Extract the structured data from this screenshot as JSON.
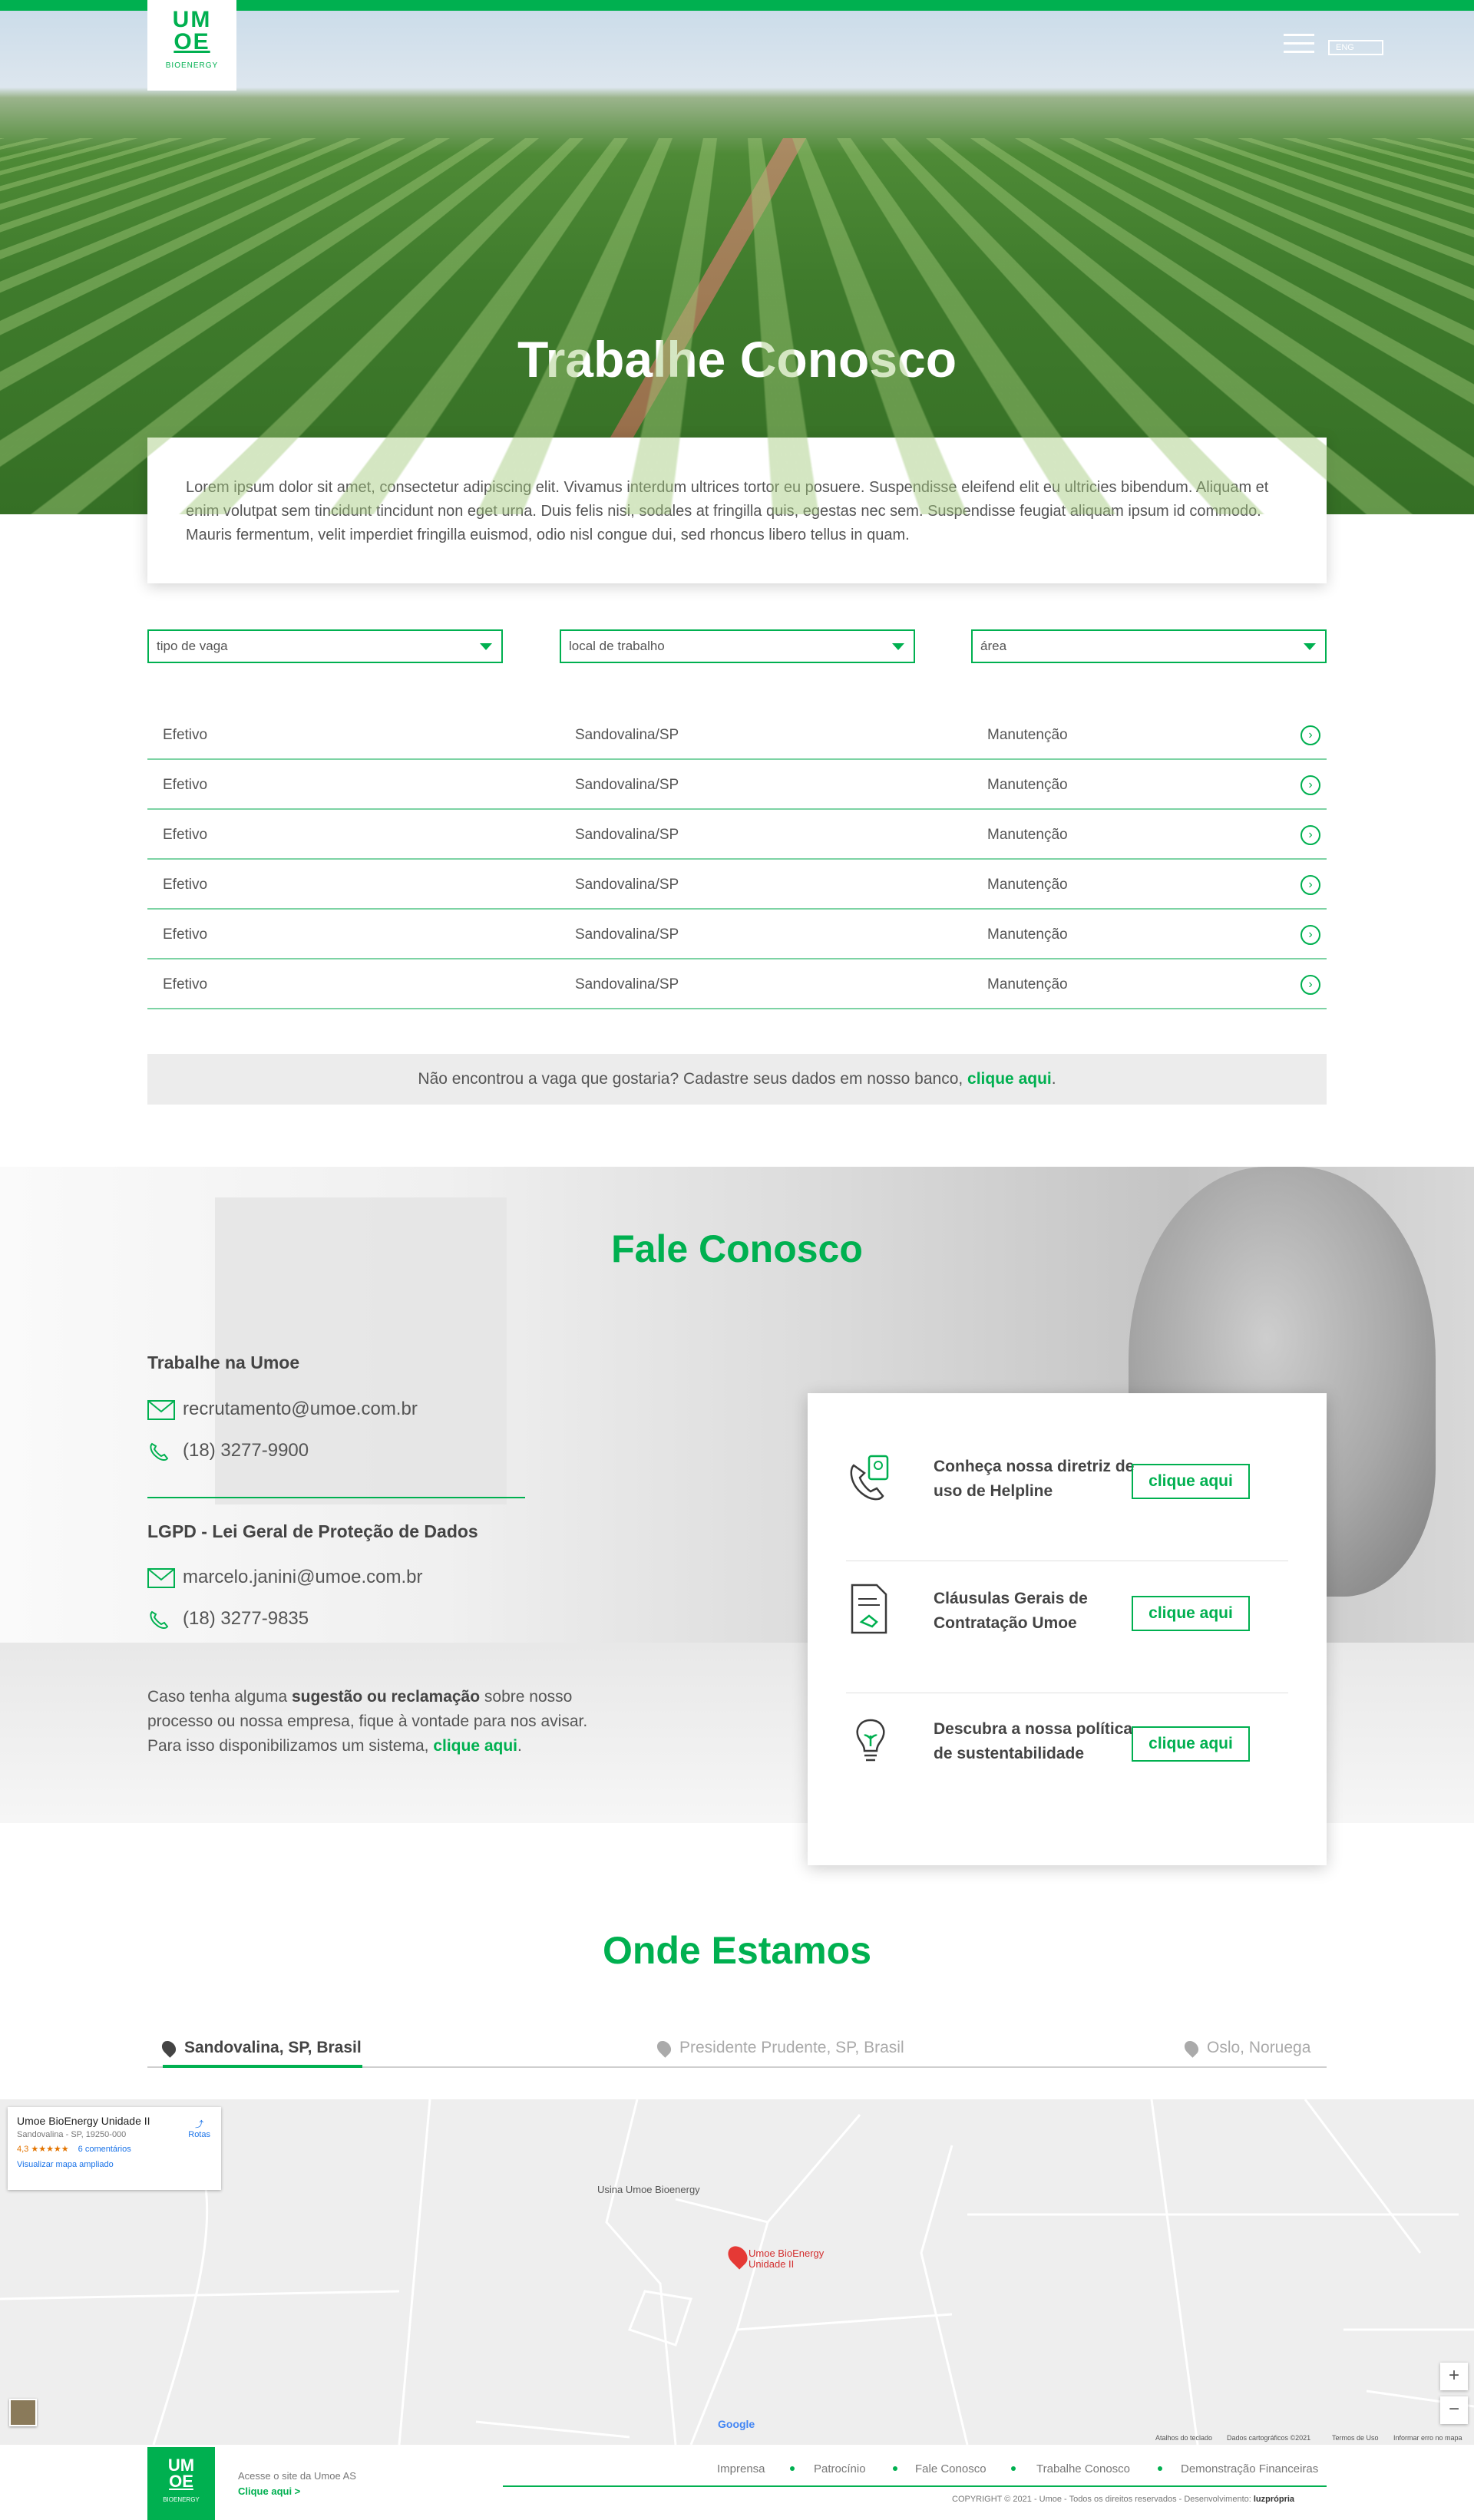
{
  "header": {
    "logo_top": "UM",
    "logo_bottom": "OE",
    "logo_sub": "BIOENERGY",
    "lang": "ENG"
  },
  "hero": {
    "title": "Trabalhe Conosco",
    "intro": "Lorem ipsum dolor sit amet, consectetur adipiscing elit. Vivamus interdum ultrices tortor eu posuere. Suspendisse eleifend elit eu ultricies bibendum. Aliquam et enim volutpat sem tincidunt tincidunt non eget urna. Duis felis nisi, sodales at fringilla quis, egestas nec sem. Suspendisse feugiat aliquam ipsum id commodo. Mauris fermentum, velit imperdiet fringilla euismod, odio nisl congue dui, sed rhoncus libero tellus in quam."
  },
  "filters": {
    "tipo": "tipo de vaga",
    "local": "local de trabalho",
    "area": "área"
  },
  "jobs": [
    {
      "tipo": "Efetivo",
      "local": "Sandovalina/SP",
      "area": "Manutenção"
    },
    {
      "tipo": "Efetivo",
      "local": "Sandovalina/SP",
      "area": "Manutenção"
    },
    {
      "tipo": "Efetivo",
      "local": "Sandovalina/SP",
      "area": "Manutenção"
    },
    {
      "tipo": "Efetivo",
      "local": "Sandovalina/SP",
      "area": "Manutenção"
    },
    {
      "tipo": "Efetivo",
      "local": "Sandovalina/SP",
      "area": "Manutenção"
    },
    {
      "tipo": "Efetivo",
      "local": "Sandovalina/SP",
      "area": "Manutenção"
    }
  ],
  "notice": {
    "text": "Não encontrou a vaga que gostaria? Cadastre seus dados em nosso banco, ",
    "link": "clique aqui",
    "end": "."
  },
  "contact": {
    "title": "Fale Conosco",
    "group1_title": "Trabalhe na Umoe",
    "group1_email": "recrutamento@umoe.com.br",
    "group1_phone": "(18) 3277-9900",
    "group2_title": "LGPD - Lei Geral de Proteção de Dados",
    "group2_email": "marcelo.janini@umoe.com.br",
    "group2_phone": "(18) 3277-9835",
    "note_1": "Caso tenha alguma ",
    "note_bold": "sugestão ou reclamação",
    "note_2": " sobre nosso processo ou nossa empresa, fique à vontade para nos avisar. Para isso disponibilizamos um sistema, ",
    "note_link": "clique aqui",
    "note_end": ".",
    "cards": [
      {
        "text": "Conheça nossa diretriz de uso de Helpline",
        "button": "clique aqui",
        "icon": "helpline-icon"
      },
      {
        "text": "Cláusulas Gerais de Contratação Umoe",
        "button": "clique aqui",
        "icon": "contract-icon"
      },
      {
        "text": "Descubra a nossa política de sustentabilidade",
        "button": "clique aqui",
        "icon": "lightbulb-icon"
      }
    ]
  },
  "where": {
    "title": "Onde Estamos",
    "tabs": [
      "Sandovalina, SP, Brasil",
      "Presidente Prudente, SP, Brasil",
      "Oslo, Noruega"
    ]
  },
  "map": {
    "place": "Umoe BioEnergy Unidade II",
    "address": "Sandovalina - SP, 19250-000",
    "rating": "4,3 ★★★★★",
    "reviews": "6 comentários",
    "enlarge": "Visualizar mapa ampliado",
    "routes": "Rotas",
    "label_usina": "Usina Umoe Bioenergy",
    "label_marker": "Umoe BioEnergy Unidade II",
    "zoom_in": "+",
    "zoom_out": "−",
    "google": "Google",
    "f1": "Atalhos do teclado",
    "f2": "Dados cartográficos ©2021",
    "f3": "Termos de Uso",
    "f4": "Informar erro no mapa"
  },
  "footer": {
    "site_line": "Acesse o site da Umoe AS",
    "site_link": "Clique aqui >",
    "nav": [
      "Imprensa",
      "Patrocínio",
      "Fale Conosco",
      "Trabalhe Conosco",
      "Demonstração Financeiras"
    ],
    "copyright": "COPYRIGHT © 2021 - Umoe - Todos os direitos reservados - Desenvolvimento: ",
    "dev": "luzprópria"
  },
  "colors": {
    "brand": "#00b050"
  }
}
